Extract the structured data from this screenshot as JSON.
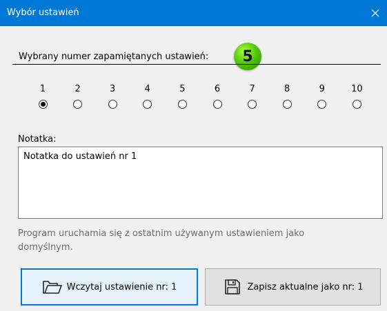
{
  "window": {
    "title": "Wybór ustawień",
    "close_label": "✕"
  },
  "settings": {
    "heading": "Wybrany numer zapamiętanych ustawień:",
    "current_number": "5",
    "options": [
      "1",
      "2",
      "3",
      "4",
      "5",
      "6",
      "7",
      "8",
      "9",
      "10"
    ],
    "selected_option": "1"
  },
  "note": {
    "label": "Notatka:",
    "value": "Notatka do ustawień nr 1"
  },
  "info": {
    "text": "Program uruchamia się z ostatnim używanym ustawieniem jako domyślnym."
  },
  "buttons": {
    "load_label": "Wczytaj ustawienie nr: 1",
    "save_label": "Zapisz aktualne jako nr: 1",
    "load_icon": "folder-open-icon",
    "save_icon": "floppy-disk-icon"
  },
  "colors": {
    "titlebar": "#0078d7",
    "badge": "#53c90a",
    "focus_border": "#0078d7"
  }
}
